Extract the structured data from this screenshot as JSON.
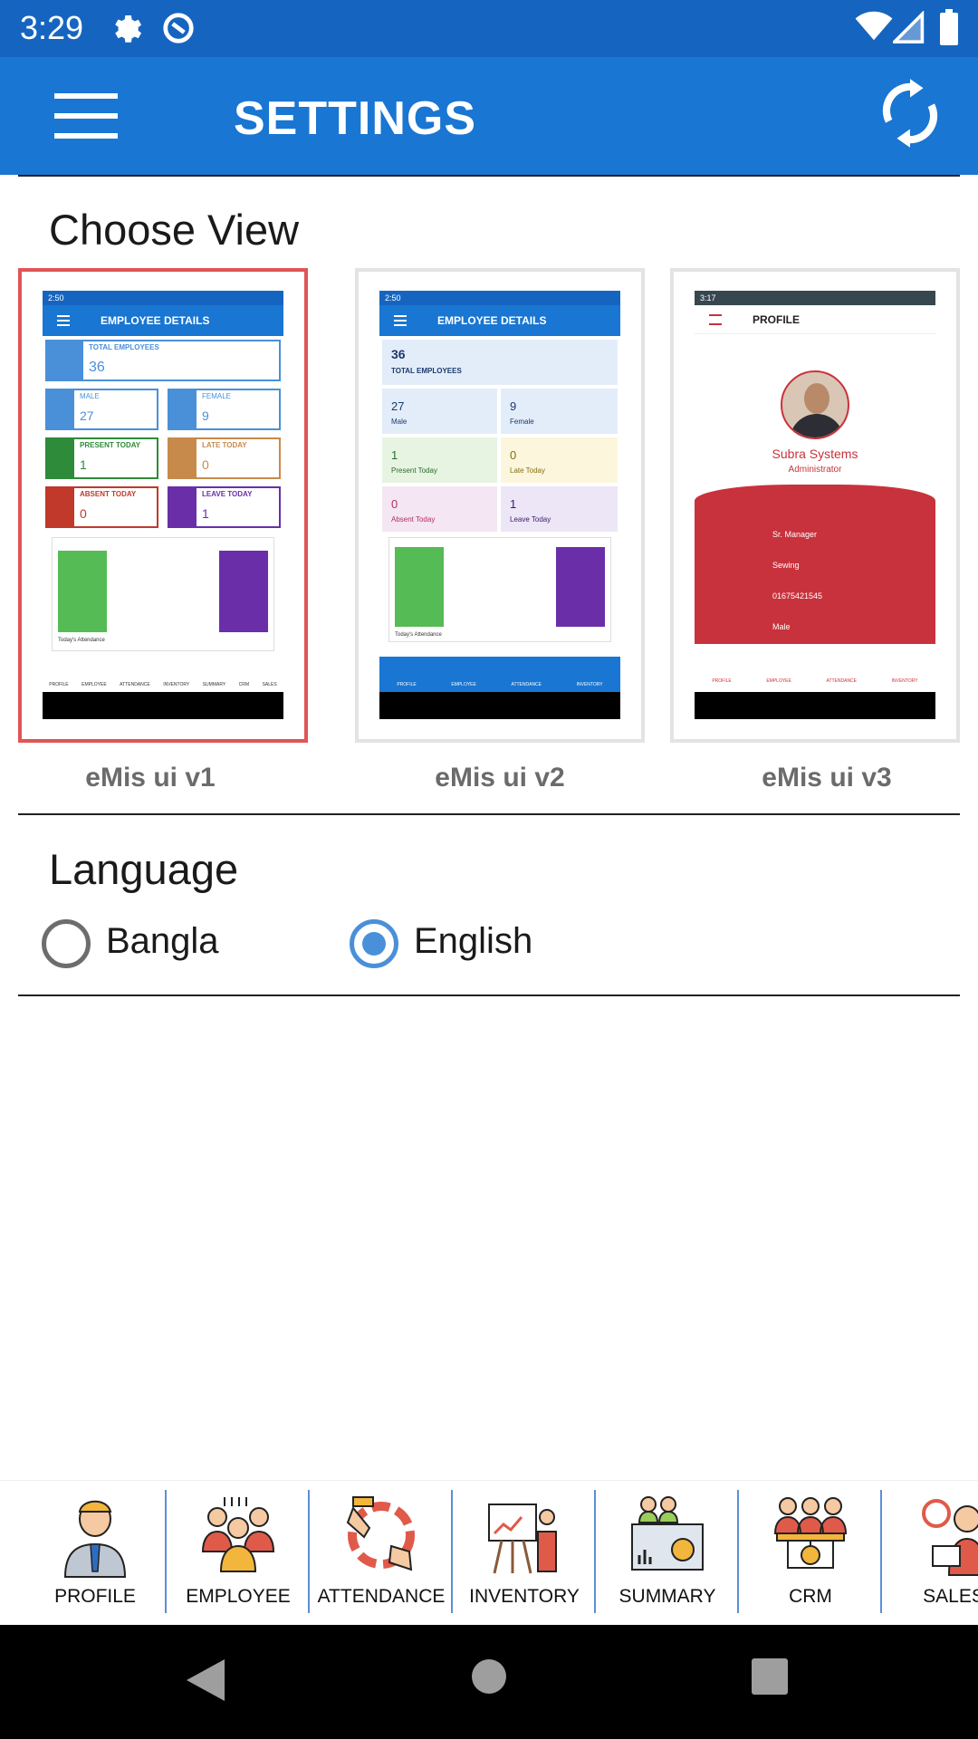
{
  "status_bar": {
    "time": "3:29",
    "icons": [
      "gear-icon",
      "sync-badge-icon",
      "wifi-icon",
      "signal-icon",
      "battery-icon"
    ]
  },
  "app_bar": {
    "title": "SETTINGS",
    "menu_icon": "hamburger-menu-icon",
    "refresh_icon": "refresh-icon",
    "color": "#1976d2"
  },
  "choose_view": {
    "title": "Choose View",
    "options": [
      {
        "label": "eMis ui v1",
        "selected": true,
        "preview": {
          "status_time": "2:50",
          "header": "EMPLOYEE DETAILS",
          "tiles": [
            {
              "label": "TOTAL EMPLOYEES",
              "value": "36"
            },
            {
              "label": "MALE",
              "value": "27"
            },
            {
              "label": "FEMALE",
              "value": "9"
            },
            {
              "label": "PRESENT TODAY",
              "value": "1"
            },
            {
              "label": "LATE TODAY",
              "value": "0"
            },
            {
              "label": "ABSENT TODAY",
              "value": "0"
            },
            {
              "label": "LEAVE TODAY",
              "value": "1"
            }
          ],
          "chart_legend": "Today's Attendance",
          "tabs": [
            "PROFILE",
            "EMPLOYEE",
            "ATTENDANCE",
            "INVENTORY",
            "SUMMARY",
            "CRM",
            "SALES"
          ]
        }
      },
      {
        "label": "eMis ui v2",
        "selected": false,
        "preview": {
          "status_time": "2:50",
          "header": "EMPLOYEE DETAILS",
          "tiles": [
            {
              "label": "TOTAL EMPLOYEES",
              "value": "36"
            },
            {
              "label": "Male",
              "value": "27"
            },
            {
              "label": "Female",
              "value": "9"
            },
            {
              "label": "Present Today",
              "value": "1"
            },
            {
              "label": "Late Today",
              "value": "0"
            },
            {
              "label": "Absent Today",
              "value": "0"
            },
            {
              "label": "Leave Today",
              "value": "1"
            }
          ],
          "chart_legend": "Today's Attendance",
          "tabs": [
            "PROFILE",
            "EMPLOYEE",
            "ATTENDANCE",
            "INVENTORY"
          ]
        }
      },
      {
        "label": "eMis ui v3",
        "selected": false,
        "preview": {
          "status_time": "3:17",
          "header": "PROFILE",
          "name": "Subra Systems",
          "role": "Administrator",
          "fields": [
            "Sr. Manager",
            "Sewing",
            "01675421545",
            "Male"
          ],
          "tabs": [
            "PROFILE",
            "EMPLOYEE",
            "ATTENDANCE",
            "INVENTORY"
          ]
        }
      }
    ]
  },
  "language": {
    "title": "Language",
    "options": [
      {
        "label": "Bangla",
        "selected": false
      },
      {
        "label": "English",
        "selected": true
      }
    ]
  },
  "bottom_nav": {
    "items": [
      {
        "label": "PROFILE",
        "icon": "businessman-icon"
      },
      {
        "label": "EMPLOYEE",
        "icon": "employee-group-icon"
      },
      {
        "label": "ATTENDANCE",
        "icon": "attendance-hands-icon"
      },
      {
        "label": "INVENTORY",
        "icon": "presentation-board-icon"
      },
      {
        "label": "SUMMARY",
        "icon": "summary-dashboard-icon"
      },
      {
        "label": "CRM",
        "icon": "crm-network-icon"
      },
      {
        "label": "SALES",
        "icon": "sales-person-icon"
      }
    ]
  },
  "system_nav": {
    "icons": [
      "back-icon",
      "home-icon",
      "recents-icon"
    ]
  },
  "colors": {
    "accent": "#4a90d9",
    "selection_border": "#e05555",
    "v3_red": "#c8323c"
  }
}
